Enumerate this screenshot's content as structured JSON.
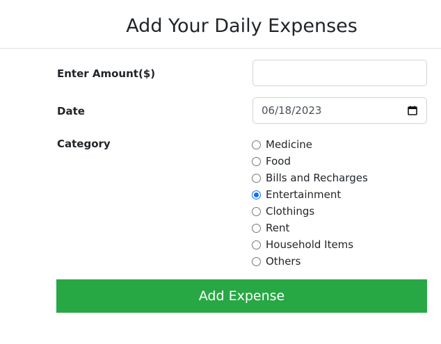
{
  "header": {
    "title": "Add Your Daily Expenses"
  },
  "form": {
    "amount": {
      "label": "Enter Amount($)",
      "value": ""
    },
    "date": {
      "label": "Date",
      "value": "06/18/2023",
      "icon": "calendar-icon"
    },
    "category": {
      "label": "Category",
      "selected": "Entertainment",
      "options": [
        "Medicine",
        "Food",
        "Bills and Recharges",
        "Entertainment",
        "Clothings",
        "Rent",
        "Household Items",
        "Others"
      ]
    },
    "submit_label": "Add Expense"
  },
  "colors": {
    "submit_bg": "#28a745",
    "radio_checked": "#0d6efd"
  }
}
